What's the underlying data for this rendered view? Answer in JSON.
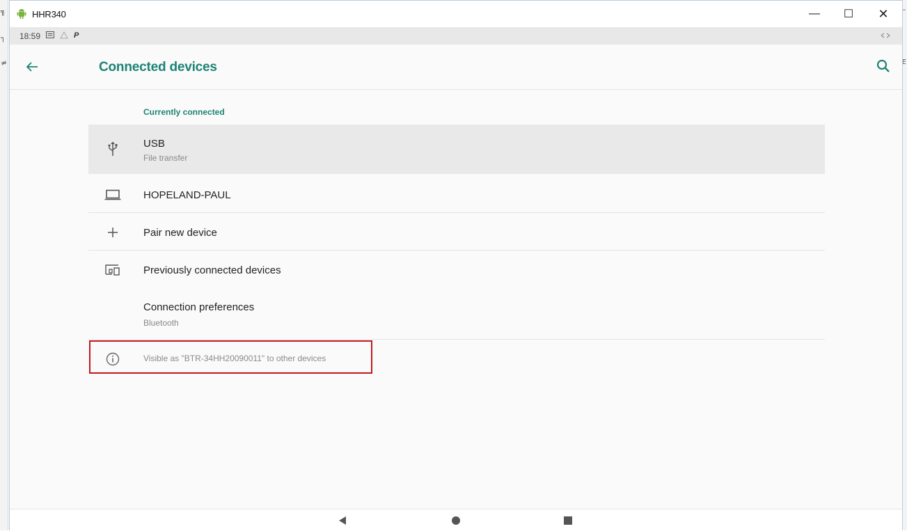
{
  "window": {
    "title": "HHR340",
    "minimize_icon": "minimize-icon",
    "maximize_icon": "maximize-icon",
    "close_icon": "close-icon",
    "min_glyph": "—",
    "max_glyph": "☐",
    "close_glyph": "✕"
  },
  "statusbar": {
    "time": "18:59",
    "icons": [
      "message-icon",
      "notification-icon",
      "p-icon"
    ],
    "right_icon": "rotate-icon"
  },
  "appbar": {
    "title": "Connected devices",
    "back_icon": "back-arrow-icon",
    "search_icon": "search-icon"
  },
  "section": {
    "label": "Currently connected"
  },
  "items": {
    "usb": {
      "title": "USB",
      "subtitle": "File transfer",
      "icon": "usb-icon"
    },
    "device": {
      "title": "HOPELAND-PAUL",
      "icon": "laptop-icon"
    },
    "pair": {
      "title": "Pair new device",
      "icon": "plus-icon"
    },
    "previous": {
      "title": "Previously connected devices",
      "icon": "devices-icon"
    },
    "preferences": {
      "title": "Connection preferences",
      "subtitle": "Bluetooth"
    }
  },
  "info": {
    "text": "Visible as \"BTR-34HH20090011\" to other devices",
    "icon": "info-icon"
  },
  "navbar": {
    "buttons": [
      "nav-back-icon",
      "nav-home-icon",
      "nav-recents-icon"
    ]
  },
  "colors": {
    "accent": "#1c8375",
    "highlight_border": "#c0181d",
    "selected_row": "#e9e9e9"
  }
}
